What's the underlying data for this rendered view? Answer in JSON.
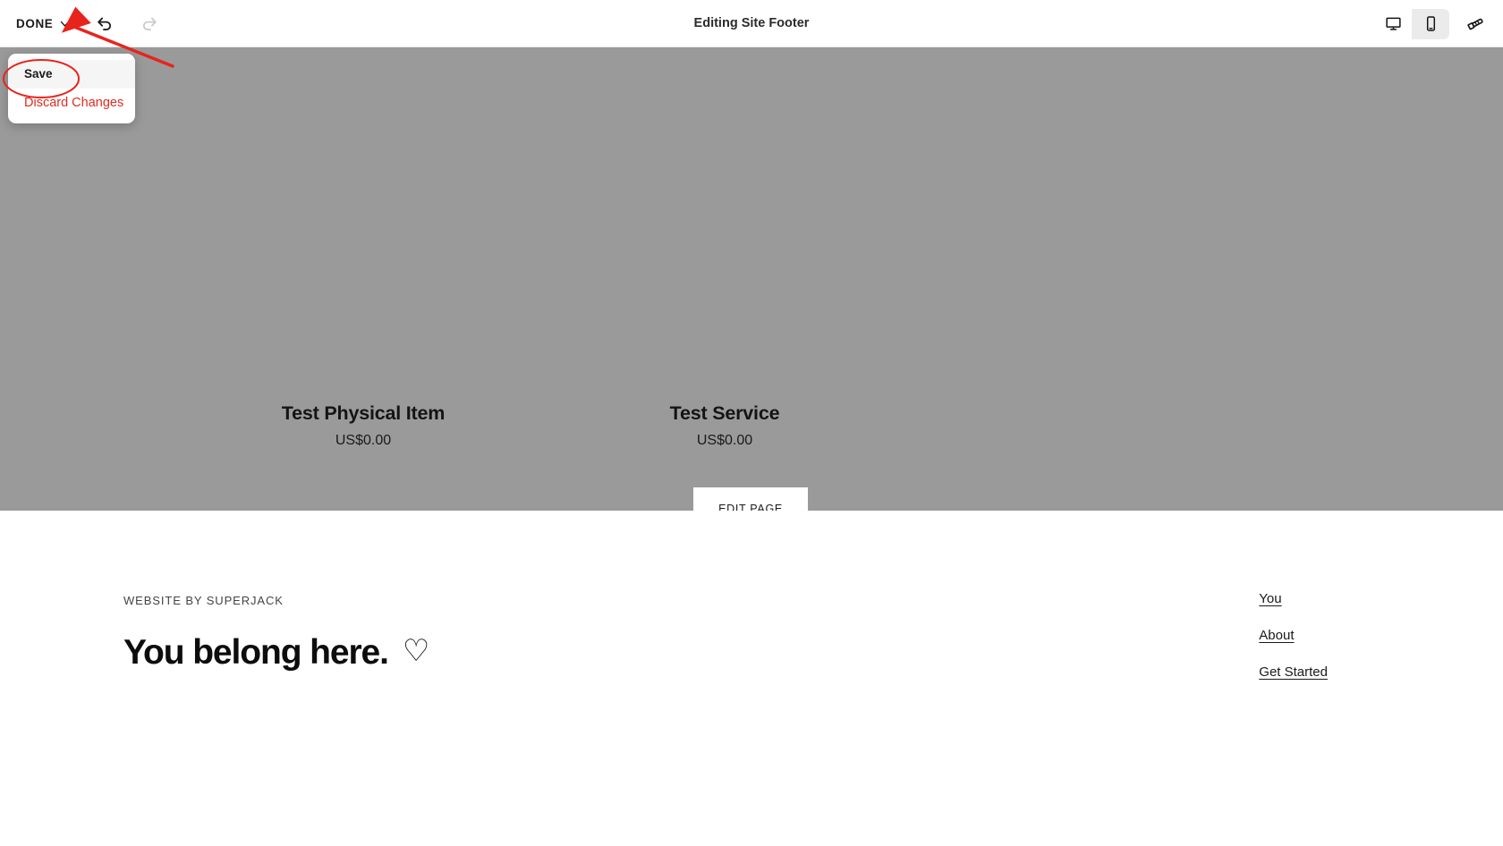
{
  "toolbar": {
    "done_label": "DONE",
    "title": "Editing Site Footer",
    "undo_icon": "undo-icon",
    "redo_icon": "redo-icon",
    "desktop_icon": "desktop-monitor-icon",
    "mobile_icon": "mobile-phone-icon",
    "brush_icon": "paintbrush-icon",
    "chevron_icon": "chevron-down-icon",
    "active_viewport": "mobile"
  },
  "dropdown": {
    "items": [
      {
        "label": "Save",
        "style": "default",
        "hovered": true
      },
      {
        "label": "Discard Changes",
        "style": "danger",
        "hovered": false
      }
    ]
  },
  "preview": {
    "overlay_color": "#9a9a9a",
    "edit_page_label": "EDIT PAGE",
    "products": [
      {
        "name": "Test Physical Item",
        "price": "US$0.00"
      },
      {
        "name": "Test Service",
        "price": "US$0.00"
      }
    ]
  },
  "site_footer": {
    "eyebrow": "WEBSITE BY SUPERJACK",
    "headline": "You belong here.",
    "heart_glyph": "♡",
    "links": [
      {
        "label": "You"
      },
      {
        "label": "About"
      },
      {
        "label": "Get Started"
      }
    ]
  },
  "annotations": {
    "accent_color": "#e8231c",
    "arrow_name": "red-arrow-pointing-to-done-chevron",
    "ellipse_name": "red-ellipse-around-save"
  }
}
